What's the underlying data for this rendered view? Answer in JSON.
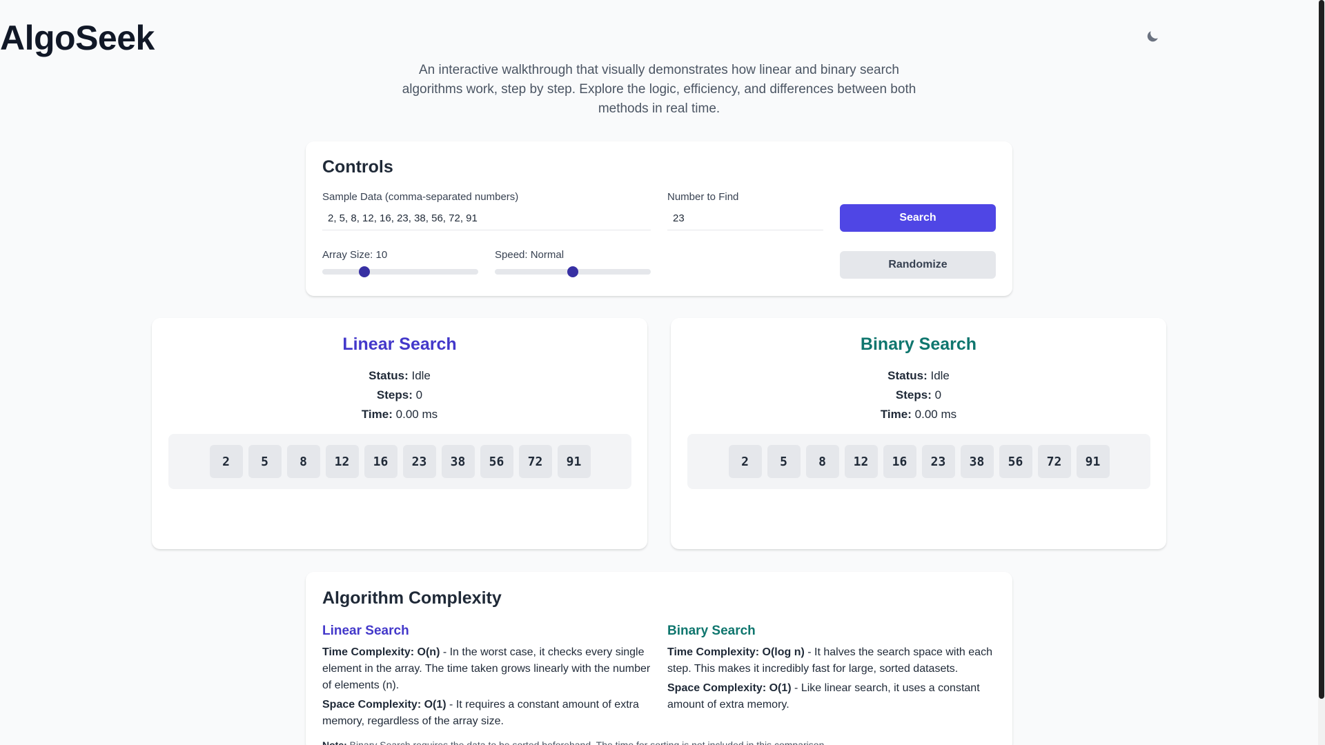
{
  "header": {
    "title": "AlgoSeek",
    "subtitle": "An interactive walkthrough that visually demonstrates how linear and binary search algorithms work, step by step. Explore the logic, efficiency, and differences between both methods in real time.",
    "theme_icon": "moon-icon"
  },
  "controls": {
    "heading": "Controls",
    "sample_data_label": "Sample Data (comma-separated numbers)",
    "sample_data_value": "2, 5, 8, 12, 16, 23, 38, 56, 72, 91",
    "number_label": "Number to Find",
    "number_value": "23",
    "search_label": "Search",
    "randomize_label": "Randomize",
    "array_size_label": "Array Size: 10",
    "array_size_value": 10,
    "speed_label": "Speed: Normal",
    "speed_value": "Normal"
  },
  "linear": {
    "title": "Linear Search",
    "status_label": "Status:",
    "status_value": "Idle",
    "steps_label": "Steps:",
    "steps_value": "0",
    "time_label": "Time:",
    "time_value": "0.00 ms",
    "array": [
      "2",
      "5",
      "8",
      "12",
      "16",
      "23",
      "38",
      "56",
      "72",
      "91"
    ]
  },
  "binary": {
    "title": "Binary Search",
    "status_label": "Status:",
    "status_value": "Idle",
    "steps_label": "Steps:",
    "steps_value": "0",
    "time_label": "Time:",
    "time_value": "0.00 ms",
    "array": [
      "2",
      "5",
      "8",
      "12",
      "16",
      "23",
      "38",
      "56",
      "72",
      "91"
    ]
  },
  "complexity": {
    "heading": "Algorithm Complexity",
    "linear": {
      "title": "Linear Search",
      "time_label": "Time Complexity: O(n)",
      "time_text": " - In the worst case, it checks every single element in the array. The time taken grows linearly with the number of elements (n).",
      "space_label": "Space Complexity: O(1)",
      "space_text": " - It requires a constant amount of extra memory, regardless of the array size."
    },
    "binary": {
      "title": "Binary Search",
      "time_label": "Time Complexity: O(log n)",
      "time_text": " - It halves the search space with each step. This makes it incredibly fast for large, sorted datasets.",
      "space_label": "Space Complexity: O(1)",
      "space_text": " - Like linear search, it uses a constant amount of extra memory."
    },
    "note_label": "Note:",
    "note_text": " Binary Search requires the data to be sorted beforehand. The time for sorting is not included in this comparison."
  },
  "colors": {
    "primary": "#4f46e5",
    "linear_accent": "#4338ca",
    "binary_accent": "#0f766e",
    "slider_thumb": "#3730a3"
  }
}
